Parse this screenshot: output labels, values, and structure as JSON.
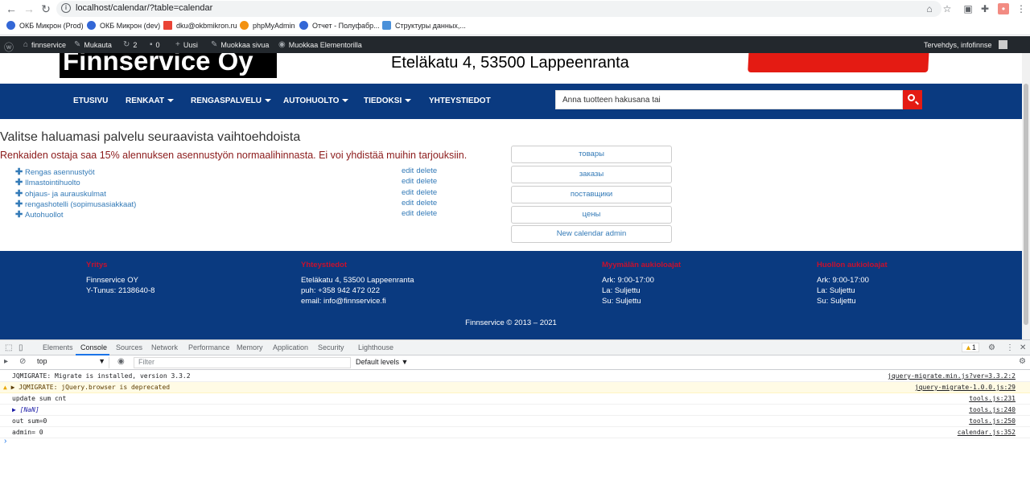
{
  "browser": {
    "url": "localhost/calendar/?table=calendar",
    "bookmarks": [
      "ОКБ Микрон (Prod)",
      "ОКБ Микрон (dev)",
      "dku@okbmikron.ru",
      "phpMyAdmin",
      "Отчет - Полуфабр...",
      "Структуры данных,..."
    ]
  },
  "wp_admin_bar": {
    "site": "finnservice",
    "customize": "Mukauta",
    "updates": "2",
    "comments": "0",
    "new": "Uusi",
    "edit_page": "Muokkaa sivua",
    "elementor": "Muokkaa Elementorilla",
    "greeting": "Tervehdys, infofinnse"
  },
  "header": {
    "logo": "Finnservice Oy",
    "address": "Eteläkatu 4, 53500 Lappeenranta"
  },
  "nav": {
    "items": [
      "ETUSIVU",
      "RENKAAT",
      "RENGASPALVELU",
      "AUTOHUOLTO",
      "TIEDOKSI",
      "YHTEYSTIEDOT"
    ],
    "search_placeholder": "Anna tuotteen hakusana tai"
  },
  "content": {
    "title": "Valitse haluamasi palvelu seuraavista vaihtoehdoista",
    "note": "Renkaiden ostaja saa 15% alennuksen asennustyön normaalihinnasta. Ei voi yhdistää muihin tarjouksiin.",
    "services": [
      "Rengas asennustyöt",
      "Ilmastointihuolto",
      "ohjaus- ja aurauskulmat",
      "rengashotelli (sopimusasiakkaat)",
      "Autohuollot"
    ],
    "edit_label": "edit",
    "delete_label": "delete",
    "side_buttons": [
      "товары",
      "заказы",
      "поставщики",
      "цены",
      "New calendar admin"
    ]
  },
  "footer": {
    "col1": {
      "head": "Yritys",
      "lines": [
        "Finnservice OY",
        "Y-Tunus: 2138640-8"
      ]
    },
    "col2": {
      "head": "Yhteystiedot",
      "lines": [
        "Eteläkatu 4, 53500 Lappeenranta",
        "puh: +358 942 472 022",
        "email: info@finnservice.fi"
      ]
    },
    "col3": {
      "head": "Myymälän aukioloajat",
      "lines": [
        "Ark: 9:00-17:00",
        "La: Suljettu",
        "Su: Suljettu"
      ]
    },
    "col4": {
      "head": "Huollon aukioloajat",
      "lines": [
        "Ark: 9:00-17:00",
        "La: Suljettu",
        "Su: Suljettu"
      ]
    },
    "copyright": "Finnservice © 2013 – 2021"
  },
  "devtools": {
    "tabs": [
      "Elements",
      "Console",
      "Sources",
      "Network",
      "Performance",
      "Memory",
      "Application",
      "Security",
      "Lighthouse"
    ],
    "active_tab": "Console",
    "warning_count": "1",
    "context": "top",
    "filter_placeholder": "Filter",
    "levels": "Default levels ▼",
    "logs": [
      {
        "text": "JQMIGRATE: Migrate is installed, version 3.3.2",
        "src": "jquery-migrate.min.js?ver=3.3.2:2",
        "type": "log"
      },
      {
        "text": "▶ JQMIGRATE: jQuery.browser is deprecated",
        "src": "jquery-migrate-1.0.0.js:29",
        "type": "warn"
      },
      {
        "text": "update sum cnt",
        "src": "tools.js:231",
        "type": "log"
      },
      {
        "text": "▶ [NaN]",
        "src": "tools.js:240",
        "type": "log"
      },
      {
        "text": "out sum=0",
        "src": "tools.js:250",
        "type": "log"
      },
      {
        "text": "admin= 0",
        "src": "calendar.js:352",
        "type": "log"
      }
    ]
  }
}
